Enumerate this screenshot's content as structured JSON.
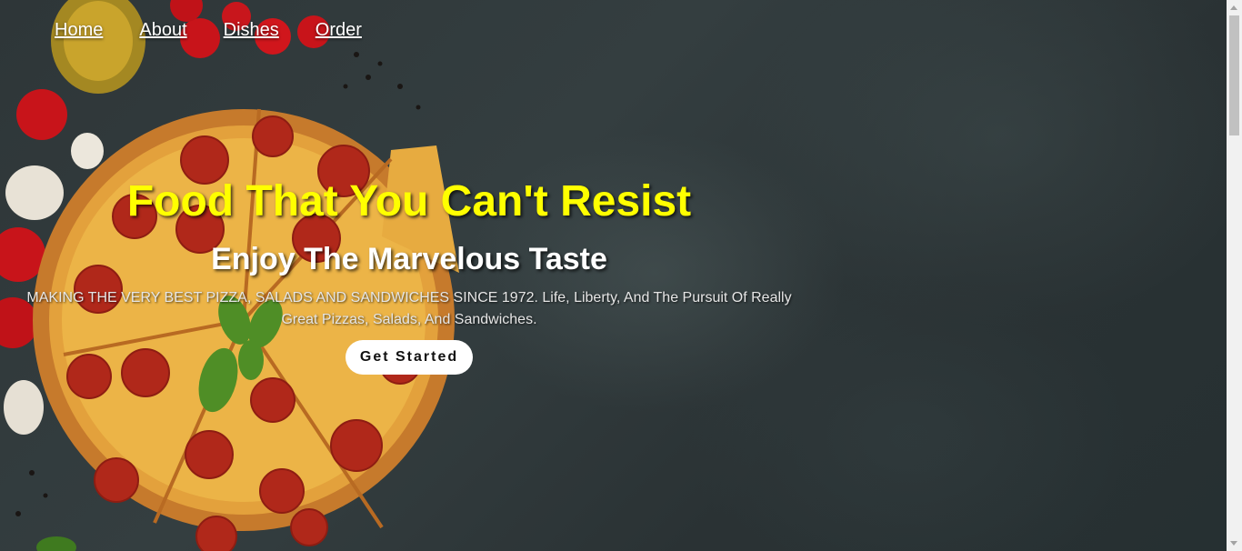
{
  "nav": {
    "items": [
      {
        "label": "Home"
      },
      {
        "label": "About"
      },
      {
        "label": "Dishes"
      },
      {
        "label": "Order"
      }
    ]
  },
  "hero": {
    "headline": "Food That You Can't Resist",
    "subheadline": "Enjoy The Marvelous Taste",
    "tagline": "MAKING THE VERY BEST PIZZA, SALADS AND SANDWICHES SINCE 1972. Life, Liberty, And The Pursuit Of Really Great Pizzas, Salads, And Sandwiches.",
    "cta_label": "Get Started",
    "background_image": "pizza-on-dark-stone-image"
  },
  "colors": {
    "headline": "#ffff00",
    "subheadline": "#ffffff",
    "nav_link": "#ffffff",
    "cta_background": "#ffffff",
    "background": "#2e3638"
  }
}
